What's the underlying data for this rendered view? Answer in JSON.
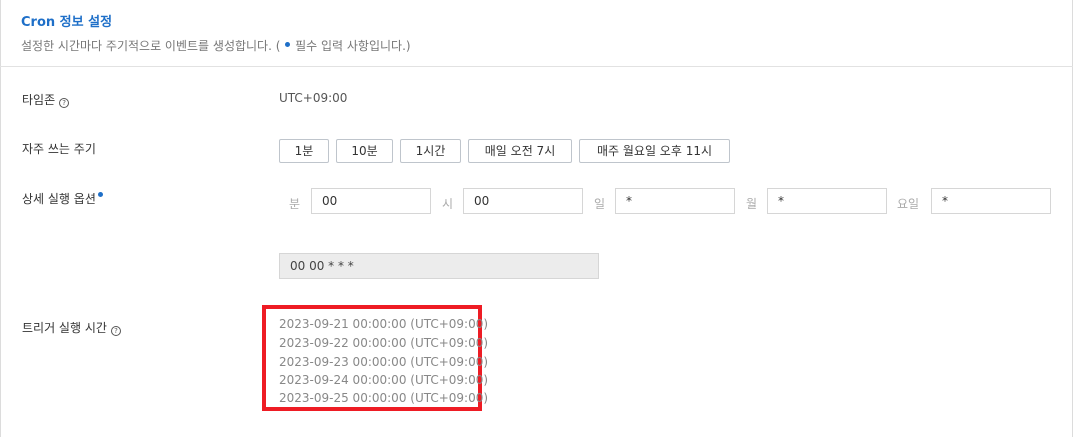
{
  "header": {
    "title": "Cron 정보 설정",
    "desc_pre": "설정한 시간마다 주기적으로 이벤트를 생성합니다. (",
    "desc_post": "필수 입력 사항입니다.)"
  },
  "timezone": {
    "label": "타임존",
    "value": "UTC+09:00"
  },
  "presets": {
    "label": "자주 쓰는 주기",
    "items": [
      "1분",
      "10분",
      "1시간",
      "매일 오전 7시",
      "매주 월요일 오후 11시"
    ]
  },
  "detail": {
    "label": "상세 실행 옵션",
    "fields": [
      {
        "label": "분",
        "value": "00"
      },
      {
        "label": "시",
        "value": "00"
      },
      {
        "label": "일",
        "value": "*"
      },
      {
        "label": "월",
        "value": "*"
      },
      {
        "label": "요일",
        "value": "*"
      }
    ],
    "expression": "00 00 * * *"
  },
  "trigger": {
    "label": "트리거 실행 시간",
    "times": [
      "2023-09-21 00:00:00 (UTC+09:00)",
      "2023-09-22 00:00:00 (UTC+09:00)",
      "2023-09-23 00:00:00 (UTC+09:00)",
      "2023-09-24 00:00:00 (UTC+09:00)",
      "2023-09-25 00:00:00 (UTC+09:00)"
    ]
  },
  "colors": {
    "accent": "#1e6fc8",
    "highlight": "#ee1c24"
  }
}
